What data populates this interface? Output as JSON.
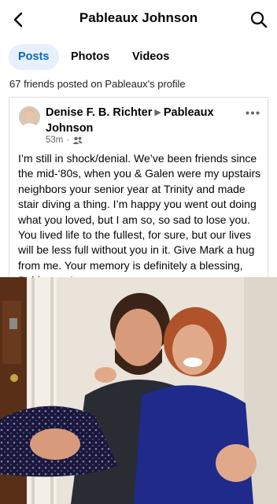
{
  "header": {
    "title": "Pableaux Johnson",
    "back_icon": "chevron-left-icon",
    "search_icon": "search-icon"
  },
  "tabs": [
    {
      "label": "Posts",
      "active": true
    },
    {
      "label": "Photos",
      "active": false
    },
    {
      "label": "Videos",
      "active": false
    }
  ],
  "friends_summary": "67 friends posted on Pableaux's profile",
  "post": {
    "author": "Denise F. B. Richter",
    "recipient": "Pableaux Johnson",
    "time": "53m",
    "audience_icon": "friends-icon",
    "more_icon": "more-horizontal-icon",
    "text": "I’m still in shock/denial. We’ve been friends since the mid-‘80s, when you & Galen were my upstairs neighbors your senior year at Trinity and made stair diving a thing. I’m happy you went out doing what you loved, but I am so, so sad to lose you. You lived life to the fullest, for sure, but our lives will be less full without you in it. Give Mark a hug from me. Your memory is definitely a blessing, Pableaux. Love you."
  },
  "colors": {
    "accent": "#0a66c2",
    "active_tab_bg": "#e7f0fc",
    "secondary_text": "#65676b"
  }
}
